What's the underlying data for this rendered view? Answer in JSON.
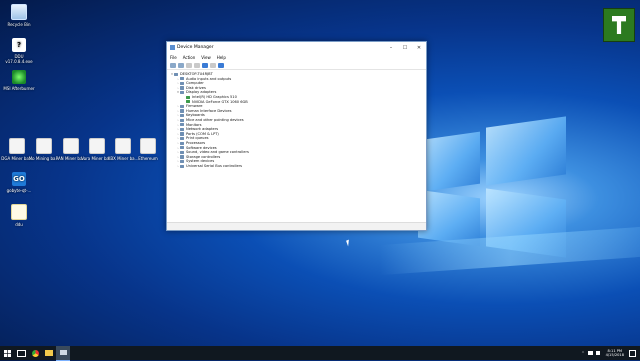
{
  "desktop": {
    "icons": [
      {
        "label": "Recycle Bin"
      },
      {
        "label": "DDU v17.0.8.4.exe"
      },
      {
        "label": "MSI Afterburner"
      },
      {
        "label": "DGA Miner ba..."
      },
      {
        "label": "Mo Mining ba..."
      },
      {
        "label": "PAN Miner ba..."
      },
      {
        "label": "Vora Miner ba..."
      },
      {
        "label": "XBX Miner ba..."
      },
      {
        "label": "Ethereum"
      },
      {
        "label": "gobyte-qt-..."
      },
      {
        "label": "ddu"
      }
    ]
  },
  "window": {
    "title": "Device Manager",
    "menu": [
      "File",
      "Action",
      "View",
      "Help"
    ],
    "tree": [
      {
        "level": 0,
        "label": "DESKTOP-TU4RJBT",
        "expander": "▾"
      },
      {
        "level": 1,
        "label": "Audio inputs and outputs",
        "expander": "›"
      },
      {
        "level": 1,
        "label": "Computer",
        "expander": "›"
      },
      {
        "level": 1,
        "label": "Disk drives",
        "expander": "›"
      },
      {
        "level": 1,
        "label": "Display adapters",
        "expander": "▾"
      },
      {
        "level": 2,
        "label": "Intel(R) HD Graphics 510",
        "expander": ""
      },
      {
        "level": 2,
        "label": "NVIDIA GeForce GTX 1060 6GB",
        "expander": ""
      },
      {
        "level": 1,
        "label": "Firmware",
        "expander": "›"
      },
      {
        "level": 1,
        "label": "Human Interface Devices",
        "expander": "›"
      },
      {
        "level": 1,
        "label": "Keyboards",
        "expander": "›"
      },
      {
        "level": 1,
        "label": "Mice and other pointing devices",
        "expander": "›"
      },
      {
        "level": 1,
        "label": "Monitors",
        "expander": "›"
      },
      {
        "level": 1,
        "label": "Network adapters",
        "expander": "›"
      },
      {
        "level": 1,
        "label": "Ports (COM & LPT)",
        "expander": "›"
      },
      {
        "level": 1,
        "label": "Print queues",
        "expander": "›"
      },
      {
        "level": 1,
        "label": "Processors",
        "expander": "›"
      },
      {
        "level": 1,
        "label": "Software devices",
        "expander": "›"
      },
      {
        "level": 1,
        "label": "Sound, video and game controllers",
        "expander": "›"
      },
      {
        "level": 1,
        "label": "Storage controllers",
        "expander": "›"
      },
      {
        "level": 1,
        "label": "System devices",
        "expander": "›"
      },
      {
        "level": 1,
        "label": "Universal Serial Bus controllers",
        "expander": "›"
      }
    ]
  },
  "taskbar": {
    "time": "8:11 PM",
    "date": "4/15/2018"
  },
  "colors": {
    "accent": "#0b4fb5",
    "taskbar": "#101820"
  }
}
